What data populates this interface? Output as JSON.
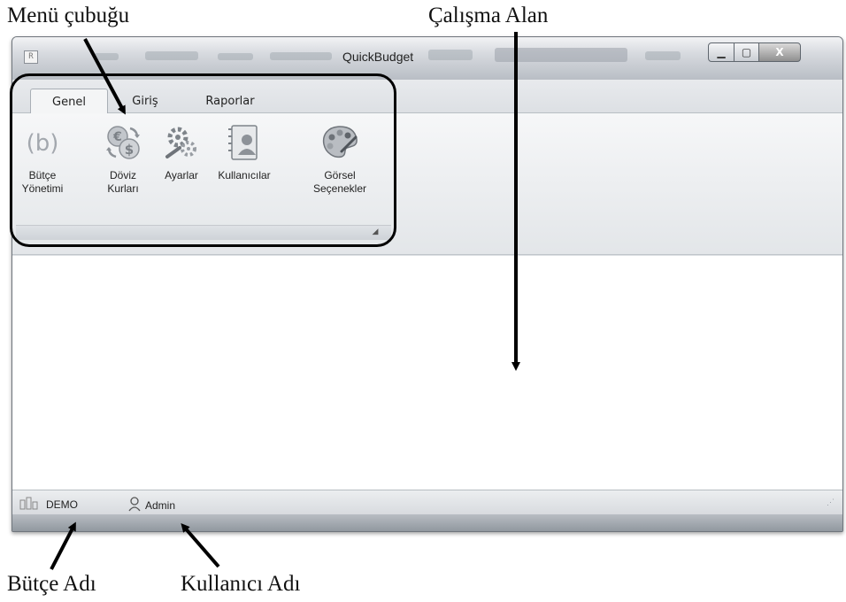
{
  "annotations": {
    "menu_bar": "Menü çubuğu",
    "work_area": "Çalışma Alan",
    "budget_name": "Bütçe Adı",
    "user_name": "Kullanıcı Adı"
  },
  "window": {
    "title": "QuickBudget",
    "controls": {
      "minimize": "▁",
      "maximize": "▢",
      "close": "X"
    }
  },
  "tabs": [
    {
      "label": "Genel",
      "selected": true
    },
    {
      "label": "Giriş",
      "selected": false
    },
    {
      "label": "Raporlar",
      "selected": false
    }
  ],
  "ribbon": {
    "items": [
      {
        "label": "Bütçe\nYönetimi",
        "icon": "budget-b-icon"
      },
      {
        "label": "Döviz\nKurları",
        "icon": "currency-exchange-icon"
      },
      {
        "label": "Ayarlar",
        "icon": "settings-icon"
      },
      {
        "label": "Kullanıcılar",
        "icon": "users-book-icon"
      },
      {
        "label": "Görsel\nSeçenekler",
        "icon": "palette-icon"
      }
    ]
  },
  "status": {
    "budget": "DEMO",
    "user": "Admin"
  },
  "colors": {
    "annotation_stroke": "#000000",
    "window_frame": "#dcdfe3",
    "close_button": "#8f8f8f"
  }
}
